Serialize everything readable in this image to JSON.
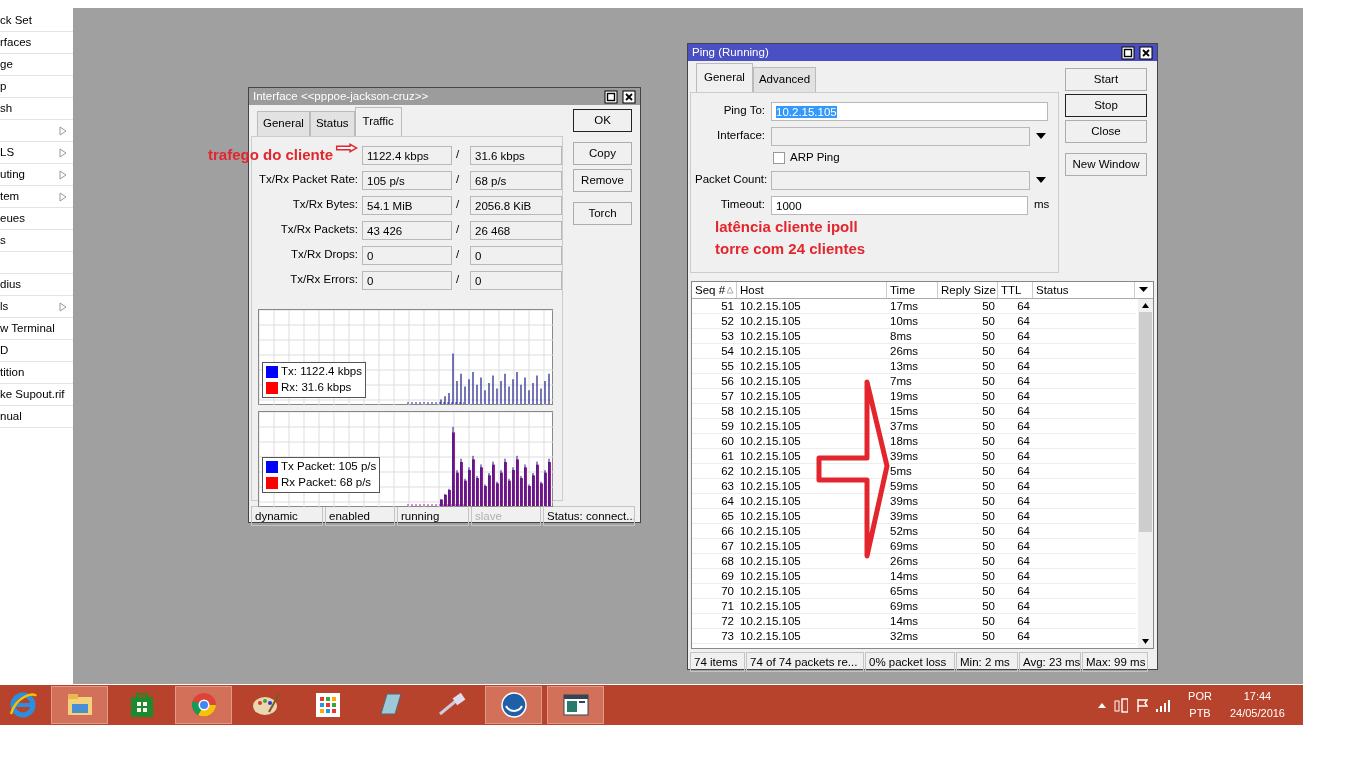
{
  "sidebar": {
    "items": [
      {
        "label": "ck Set",
        "has_submenu": false
      },
      {
        "label": "rfaces",
        "has_submenu": false
      },
      {
        "label": "ge",
        "has_submenu": false
      },
      {
        "label": "p",
        "has_submenu": false
      },
      {
        "label": "sh",
        "has_submenu": false
      },
      {
        "has_submenu": true
      },
      {
        "label": "LS",
        "has_submenu": true
      },
      {
        "label": "uting",
        "has_submenu": true
      },
      {
        "label": "tem",
        "has_submenu": true
      },
      {
        "label": "eues",
        "has_submenu": false
      },
      {
        "label": "s",
        "has_submenu": false
      },
      {
        "has_submenu": false
      },
      {
        "label": "dius",
        "has_submenu": false
      },
      {
        "label": "ls",
        "has_submenu": true
      },
      {
        "label": "w Terminal",
        "has_submenu": false
      },
      {
        "label": "D",
        "has_submenu": false
      },
      {
        "label": "tition",
        "has_submenu": false
      },
      {
        "label": "ke Supout.rif",
        "has_submenu": false
      },
      {
        "label": "nual",
        "has_submenu": false
      }
    ]
  },
  "interface_window": {
    "title": "Interface <<pppoe-jackson-cruz>>",
    "active": false,
    "tabs": [
      {
        "label": "General",
        "selected": false
      },
      {
        "label": "Status",
        "selected": false
      },
      {
        "label": "Traffic",
        "selected": true
      }
    ],
    "annotation": "trafego do cliente",
    "stats": [
      {
        "tx": "1122.4 kbps",
        "separator": "/",
        "rx": "31.6 kbps"
      },
      {
        "label": "Tx/Rx Packet Rate:",
        "tx": "105 p/s",
        "separator": "/",
        "rx": "68 p/s"
      },
      {
        "label": "Tx/Rx Bytes:",
        "tx": "54.1 MiB",
        "separator": "/",
        "rx": "2056.8 KiB"
      },
      {
        "label": "Tx/Rx Packets:",
        "tx": "43 426",
        "separator": "/",
        "rx": "26 468"
      },
      {
        "label": "Tx/Rx Drops:",
        "tx": "0",
        "separator": "/",
        "rx": "0"
      },
      {
        "label": "Tx/Rx Errors:",
        "tx": "0",
        "separator": "/",
        "rx": "0"
      }
    ],
    "graphs": [
      {
        "kind": "rate",
        "legend": [
          {
            "text": "Tx:  1122.4 kbps",
            "color": "#0000ff"
          },
          {
            "text": "Rx:  31.6 kbps",
            "color": "#ff0000"
          }
        ]
      },
      {
        "kind": "packet",
        "legend": [
          {
            "text": "Tx Packet:  105 p/s",
            "color": "#0000ff"
          },
          {
            "text": "Rx Packet:  68 p/s",
            "color": "#ff0000"
          }
        ]
      }
    ],
    "buttons": [
      {
        "label": "OK",
        "default": true
      },
      {
        "label": "Copy",
        "default": false
      },
      {
        "label": "Remove",
        "default": false
      },
      {
        "label": "Torch",
        "default": false
      }
    ],
    "status_bar": [
      {
        "text": "dynamic",
        "disabled": false
      },
      {
        "text": "enabled",
        "disabled": false
      },
      {
        "text": "running",
        "disabled": false
      },
      {
        "text": "slave",
        "disabled": true
      },
      {
        "text": "Status: connect...",
        "disabled": false
      }
    ]
  },
  "ping_window": {
    "title": "Ping (Running)",
    "active": true,
    "tabs": [
      {
        "label": "General",
        "selected": true
      },
      {
        "label": "Advanced",
        "selected": false
      }
    ],
    "fields": [
      {
        "kind": "text",
        "label": "Ping To:",
        "value": "10.2.15.105",
        "highlighted": true
      },
      {
        "kind": "dropdown",
        "label": "Interface:"
      },
      {
        "kind": "checkbox",
        "label": "ARP Ping",
        "checked": false
      },
      {
        "kind": "dropdown",
        "label": "Packet Count:"
      },
      {
        "kind": "text",
        "label": "Timeout:",
        "value": "1000",
        "unit": "ms",
        "highlighted": false
      }
    ],
    "annotation": [
      "latência cliente ipoll",
      "torre com 24 clientes"
    ],
    "buttons": [
      {
        "label": "Start",
        "default": false
      },
      {
        "label": "Stop",
        "default": true
      },
      {
        "label": "Close",
        "default": false
      },
      {
        "label": "New Window",
        "default": false
      }
    ],
    "table": {
      "columns": [
        {
          "label": "Seq #",
          "sorted": true
        },
        {
          "label": "Host"
        },
        {
          "label": "Time"
        },
        {
          "label": "Reply Size"
        },
        {
          "label": "TTL"
        },
        {
          "label": "Status"
        }
      ],
      "rows": [
        [
          "51",
          "10.2.15.105",
          "17ms",
          "50",
          "64"
        ],
        [
          "52",
          "10.2.15.105",
          "10ms",
          "50",
          "64"
        ],
        [
          "53",
          "10.2.15.105",
          "8ms",
          "50",
          "64"
        ],
        [
          "54",
          "10.2.15.105",
          "26ms",
          "50",
          "64"
        ],
        [
          "55",
          "10.2.15.105",
          "13ms",
          "50",
          "64"
        ],
        [
          "56",
          "10.2.15.105",
          "7ms",
          "50",
          "64"
        ],
        [
          "57",
          "10.2.15.105",
          "19ms",
          "50",
          "64"
        ],
        [
          "58",
          "10.2.15.105",
          "15ms",
          "50",
          "64"
        ],
        [
          "59",
          "10.2.15.105",
          "37ms",
          "50",
          "64"
        ],
        [
          "60",
          "10.2.15.105",
          "18ms",
          "50",
          "64"
        ],
        [
          "61",
          "10.2.15.105",
          "39ms",
          "50",
          "64"
        ],
        [
          "62",
          "10.2.15.105",
          "5ms",
          "50",
          "64"
        ],
        [
          "63",
          "10.2.15.105",
          "59ms",
          "50",
          "64"
        ],
        [
          "64",
          "10.2.15.105",
          "39ms",
          "50",
          "64"
        ],
        [
          "65",
          "10.2.15.105",
          "39ms",
          "50",
          "64"
        ],
        [
          "66",
          "10.2.15.105",
          "52ms",
          "50",
          "64"
        ],
        [
          "67",
          "10.2.15.105",
          "69ms",
          "50",
          "64"
        ],
        [
          "68",
          "10.2.15.105",
          "26ms",
          "50",
          "64"
        ],
        [
          "69",
          "10.2.15.105",
          "14ms",
          "50",
          "64"
        ],
        [
          "70",
          "10.2.15.105",
          "65ms",
          "50",
          "64"
        ],
        [
          "71",
          "10.2.15.105",
          "69ms",
          "50",
          "64"
        ],
        [
          "72",
          "10.2.15.105",
          "14ms",
          "50",
          "64"
        ],
        [
          "73",
          "10.2.15.105",
          "32ms",
          "50",
          "64"
        ]
      ]
    },
    "status_bar": [
      "74 items",
      "74 of 74 packets re...",
      "0% packet loss",
      "Min: 2 ms",
      "Avg: 23 ms",
      "Max: 99 ms"
    ]
  },
  "taskbar": {
    "apps": [
      {
        "kind": "browser-e",
        "highlighted": false
      },
      {
        "kind": "folder",
        "highlighted": true
      },
      {
        "kind": "store",
        "highlighted": false
      },
      {
        "kind": "chrome",
        "highlighted": true
      },
      {
        "kind": "palette",
        "highlighted": false
      },
      {
        "kind": "tiles",
        "highlighted": false
      },
      {
        "kind": "notepad",
        "highlighted": false
      },
      {
        "kind": "cable",
        "highlighted": false
      },
      {
        "kind": "winbox",
        "highlighted": true
      },
      {
        "kind": "window",
        "highlighted": true
      }
    ],
    "language": "POR",
    "layout": "PTB",
    "time": "17:44",
    "date": "24/05/2016"
  }
}
